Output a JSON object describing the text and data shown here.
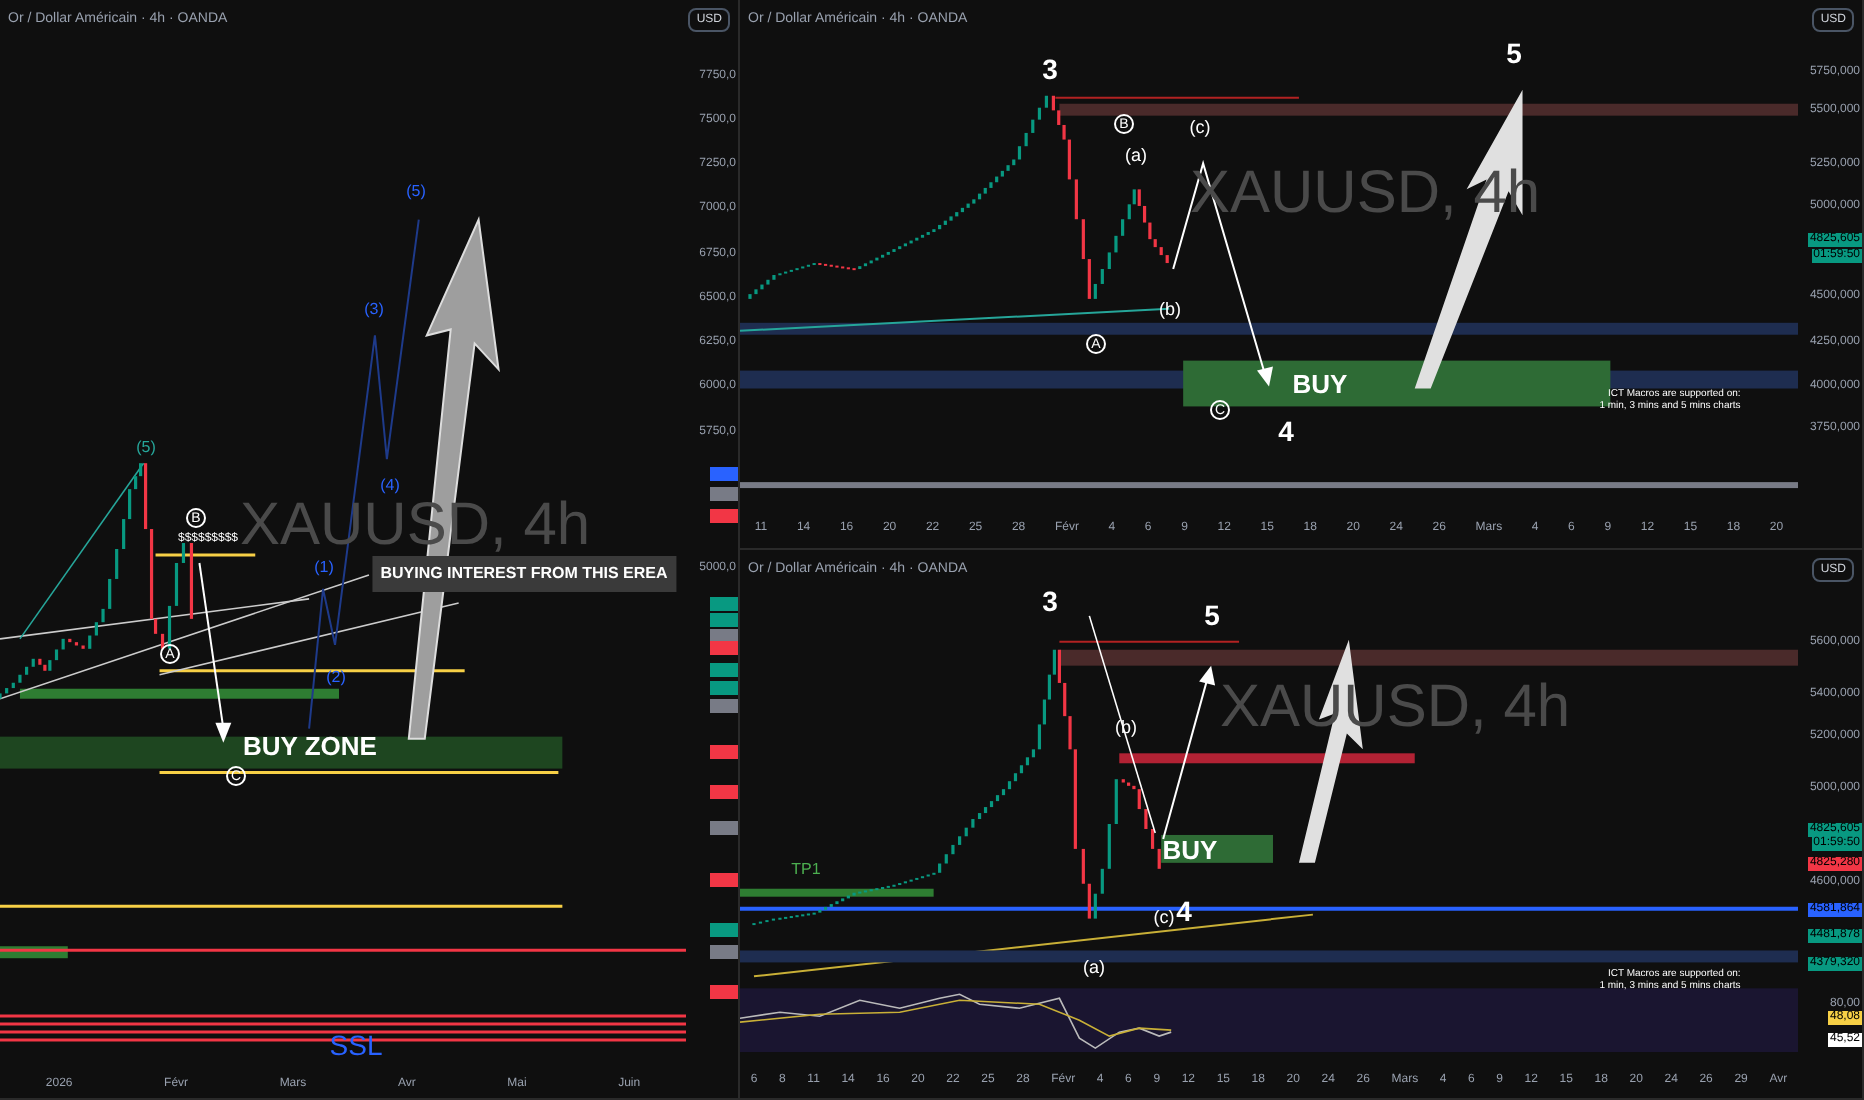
{
  "panels": [
    {
      "title": "Or / Dollar Américain · 4h · OANDA",
      "currency_button": "USD",
      "watermark": "XAUUSD, 4h",
      "price_axis": [
        "7750,0",
        "7500,0",
        "7250,0",
        "7000,0",
        "6750,0",
        "6500,0",
        "6250,0",
        "6000,0",
        "5750,0",
        "5000,0"
      ],
      "price_tags": [
        {
          "color": "#2962ff"
        },
        {
          "color": "#787b86"
        },
        {
          "color": "#f23645"
        },
        {
          "color": "#089981"
        },
        {
          "color": "#089981"
        },
        {
          "color": "#787b86"
        },
        {
          "color": "#f23645"
        },
        {
          "color": "#089981"
        },
        {
          "color": "#089981"
        },
        {
          "color": "#787b86"
        },
        {
          "color": "#f23645"
        },
        {
          "color": "#f23645"
        },
        {
          "color": "#787b86"
        },
        {
          "color": "#f23645"
        },
        {
          "color": "#089981"
        },
        {
          "color": "#787b86"
        },
        {
          "color": "#f23645"
        }
      ],
      "date_axis": [
        "2026",
        "Févr",
        "Mars",
        "Avr",
        "Mai",
        "Juin"
      ],
      "annotations": [
        {
          "kind": "teal-wave",
          "text": "(5)"
        },
        {
          "kind": "circled",
          "text": "B"
        },
        {
          "kind": "liquidity",
          "text": "$$$$$$$$$"
        },
        {
          "kind": "circled",
          "text": "A"
        },
        {
          "kind": "circled",
          "text": "C"
        },
        {
          "kind": "blue-wave",
          "text": "(1)"
        },
        {
          "kind": "blue-wave",
          "text": "(2)"
        },
        {
          "kind": "blue-wave",
          "text": "(3)"
        },
        {
          "kind": "blue-wave",
          "text": "(4)"
        },
        {
          "kind": "blue-wave",
          "text": "(5)"
        },
        {
          "kind": "callout",
          "text": "BUYING INTEREST FROM THIS EREA"
        },
        {
          "kind": "zone-label",
          "text": "BUY ZONE"
        },
        {
          "kind": "ssl",
          "text": "SSL"
        }
      ]
    },
    {
      "title": "Or / Dollar Américain · 4h · OANDA",
      "currency_button": "USD",
      "watermark": "XAUUSD, 4h",
      "price_axis": [
        "5750,000",
        "5500,000",
        "5250,000",
        "5000,000",
        "4500,000",
        "4250,000",
        "4000,000",
        "3750,000"
      ],
      "price_tags": [
        {
          "text": "4825,605",
          "color": "#089981"
        },
        {
          "text": "01:59:50",
          "color": "#089981"
        }
      ],
      "date_axis": [
        "11",
        "14",
        "16",
        "20",
        "22",
        "25",
        "28",
        "Févr",
        "4",
        "6",
        "9",
        "12",
        "15",
        "18",
        "20",
        "24",
        "26",
        "Mars",
        "4",
        "6",
        "9",
        "12",
        "15",
        "18",
        "20"
      ],
      "annotations": [
        {
          "kind": "wave",
          "text": "3"
        },
        {
          "kind": "wave",
          "text": "5"
        },
        {
          "kind": "circled",
          "text": "B"
        },
        {
          "kind": "sub-wave",
          "text": "(a)"
        },
        {
          "kind": "sub-wave",
          "text": "(c)"
        },
        {
          "kind": "sub-wave",
          "text": "(b)"
        },
        {
          "kind": "circled",
          "text": "A"
        },
        {
          "kind": "circled",
          "text": "C"
        },
        {
          "kind": "wave",
          "text": "4"
        },
        {
          "kind": "zone-label",
          "text": "BUY"
        },
        {
          "kind": "note",
          "text": "ICT Macros are supported on:\n1 min, 3 mins and 5 mins charts"
        }
      ]
    },
    {
      "title": "Or / Dollar Américain · 4h · OANDA",
      "currency_button": "USD",
      "watermark": "XAUUSD, 4h",
      "price_axis": [
        "5600,000",
        "5400,000",
        "5200,000",
        "5000,000",
        "4600,000",
        "80,00"
      ],
      "price_tags": [
        {
          "text": "4825,605",
          "color": "#089981"
        },
        {
          "text": "01:59:50",
          "color": "#089981"
        },
        {
          "text": "4825,280",
          "color": "#f23645"
        },
        {
          "text": "4581,864",
          "color": "#2962ff"
        },
        {
          "text": "4481,878",
          "color": "#089981"
        },
        {
          "text": "4379,320",
          "color": "#089981"
        },
        {
          "text": "48,08",
          "color": "#f7d046"
        },
        {
          "text": "45,52",
          "color": "#ffffff"
        }
      ],
      "date_axis": [
        "6",
        "8",
        "11",
        "14",
        "16",
        "20",
        "22",
        "25",
        "28",
        "Févr",
        "4",
        "6",
        "9",
        "12",
        "15",
        "18",
        "20",
        "24",
        "26",
        "Mars",
        "4",
        "6",
        "9",
        "12",
        "15",
        "18",
        "20",
        "24",
        "26",
        "29",
        "Avr"
      ],
      "annotations": [
        {
          "kind": "wave",
          "text": "3"
        },
        {
          "kind": "wave",
          "text": "5"
        },
        {
          "kind": "sub-wave",
          "text": "(b)"
        },
        {
          "kind": "zone-label",
          "text": "BUY"
        },
        {
          "kind": "sub-wave",
          "text": "(c)"
        },
        {
          "kind": "wave",
          "text": "4"
        },
        {
          "kind": "sub-wave",
          "text": "(a)"
        },
        {
          "kind": "tp",
          "text": "TP1"
        },
        {
          "kind": "note",
          "text": "ICT Macros are supported on:\n1 min, 3 mins and 5 mins charts"
        }
      ]
    }
  ]
}
